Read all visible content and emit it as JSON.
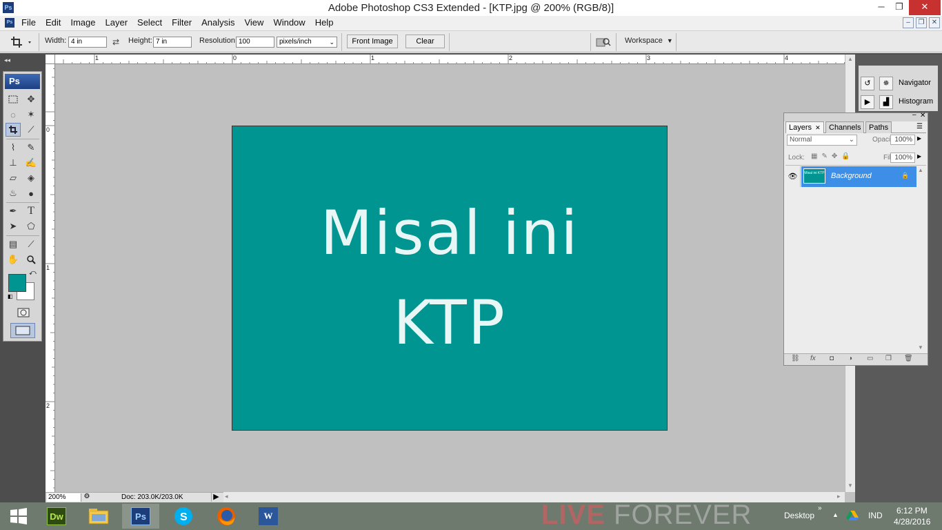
{
  "window": {
    "title": "Adobe Photoshop CS3 Extended - [KTP.jpg @ 200% (RGB/8)]",
    "app_icon": "Ps",
    "controls": {
      "minimize": "─",
      "restore": "❐",
      "close": "✕"
    }
  },
  "menu": {
    "items": [
      "File",
      "Edit",
      "Image",
      "Layer",
      "Select",
      "Filter",
      "Analysis",
      "View",
      "Window",
      "Help"
    ],
    "mdi": {
      "minimize": "–",
      "restore": "❐",
      "close": "✕"
    }
  },
  "options": {
    "width_label": "Width:",
    "width_value": "4 in",
    "height_label": "Height:",
    "height_value": "7 in",
    "resolution_label": "Resolution:",
    "resolution_value": "100",
    "units_value": "pixels/inch",
    "front_image_label": "Front Image",
    "clear_label": "Clear",
    "workspace_label": "Workspace"
  },
  "toolbox": {
    "badge": "Ps",
    "foreground_color": "#009590",
    "background_color": "#ffffff"
  },
  "rulers": {
    "top": [
      "1",
      "0",
      "1",
      "2",
      "3",
      "4"
    ],
    "left": [
      "0",
      "1",
      "2"
    ]
  },
  "document": {
    "fill_color": "#009590",
    "line1": "Misal ini",
    "line2": "KTP"
  },
  "status": {
    "zoom": "200%",
    "doc_info": "Doc: 203.0K/203.0K"
  },
  "mini_panels": {
    "navigator": "Navigator",
    "histogram": "Histogram"
  },
  "layers_panel": {
    "tabs": [
      "Layers",
      "Channels",
      "Paths"
    ],
    "blend_mode": "Normal",
    "opacity_label": "Opacity:",
    "opacity_value": "100%",
    "lock_label": "Lock:",
    "fill_label": "Fill:",
    "fill_value": "100%",
    "layer_name": "Background",
    "thumb_text": "Misal ini KTP"
  },
  "taskbar": {
    "apps": [
      "Dw",
      "Ps",
      "W"
    ],
    "watermark_live": "LIVE",
    "watermark_forever": "FOREVER",
    "desktop": "Desktop",
    "language": "IND",
    "time": "6:12 PM",
    "date": "4/28/2016"
  }
}
